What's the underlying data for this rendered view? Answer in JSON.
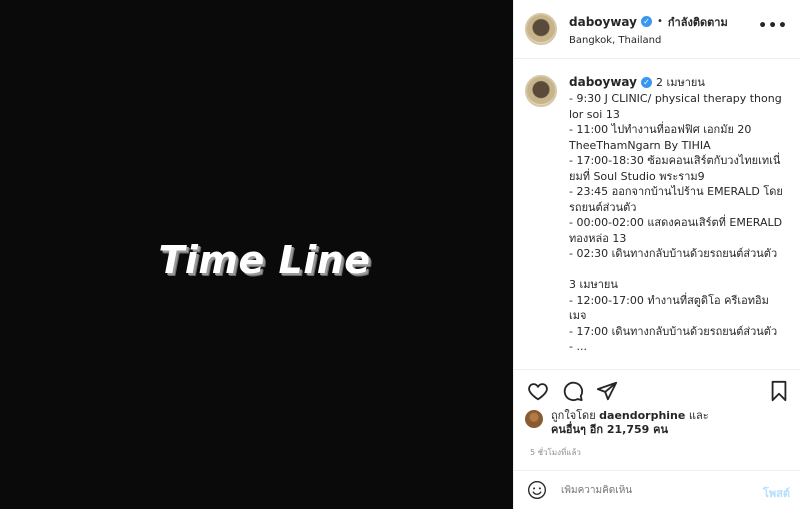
{
  "media": {
    "text": "Time Line"
  },
  "header": {
    "username": "daboyway",
    "separator": "•",
    "follow_status": "กำลังติดตาม",
    "location": "Bangkok, Thailand",
    "more": "•••"
  },
  "caption": {
    "username": "daboyway",
    "date": "2 เมษายน",
    "lines": [
      "- 9:30 J CLINIC/ physical therapy thong lor soi 13",
      "- 11:00 ไปทำงานที่ออฟฟิศ เอกมัย 20 TheeThamNgarn By TIHIA",
      "- 17:00-18:30 ซ้อมคอนเสิร์ตกับวงไทยเทเนี่ยมที่ Soul Studio พระราม9",
      "- 23:45 ออกจากบ้านไปร้าน EMERALD โดยรถยนต์ส่วนตัว",
      "- 00:00-02:00 แสดงคอนเสิร์ตที่ EMERALD ทองหล่อ 13",
      "- 02:30 เดินทางกลับบ้านด้วยรถยนต์ส่วนตัว",
      "",
      "3 เมษายน",
      "- 12:00-17:00 ทำงานที่สตูดิโอ ครีเอทอิมเมจ",
      "- 17:00 เดินทางกลับบ้านด้วยรถยนต์ส่วนตัว",
      "- ..."
    ]
  },
  "actions": {
    "like_icon": "heart-icon",
    "comment_icon": "comment-icon",
    "share_icon": "share-icon",
    "save_icon": "bookmark-icon"
  },
  "likes": {
    "prefix": "ถูกใจโดย",
    "first_user": "daendorphine",
    "conjunction": "และ",
    "others": "คนอื่นๆ อีก 21,759 คน"
  },
  "timestamp": "5 ชั่วโมงที่แล้ว",
  "comment": {
    "emoji_icon": "smiley-icon",
    "placeholder": "เพิ่มความคิดเห็น",
    "post_label": "โพสต์"
  }
}
